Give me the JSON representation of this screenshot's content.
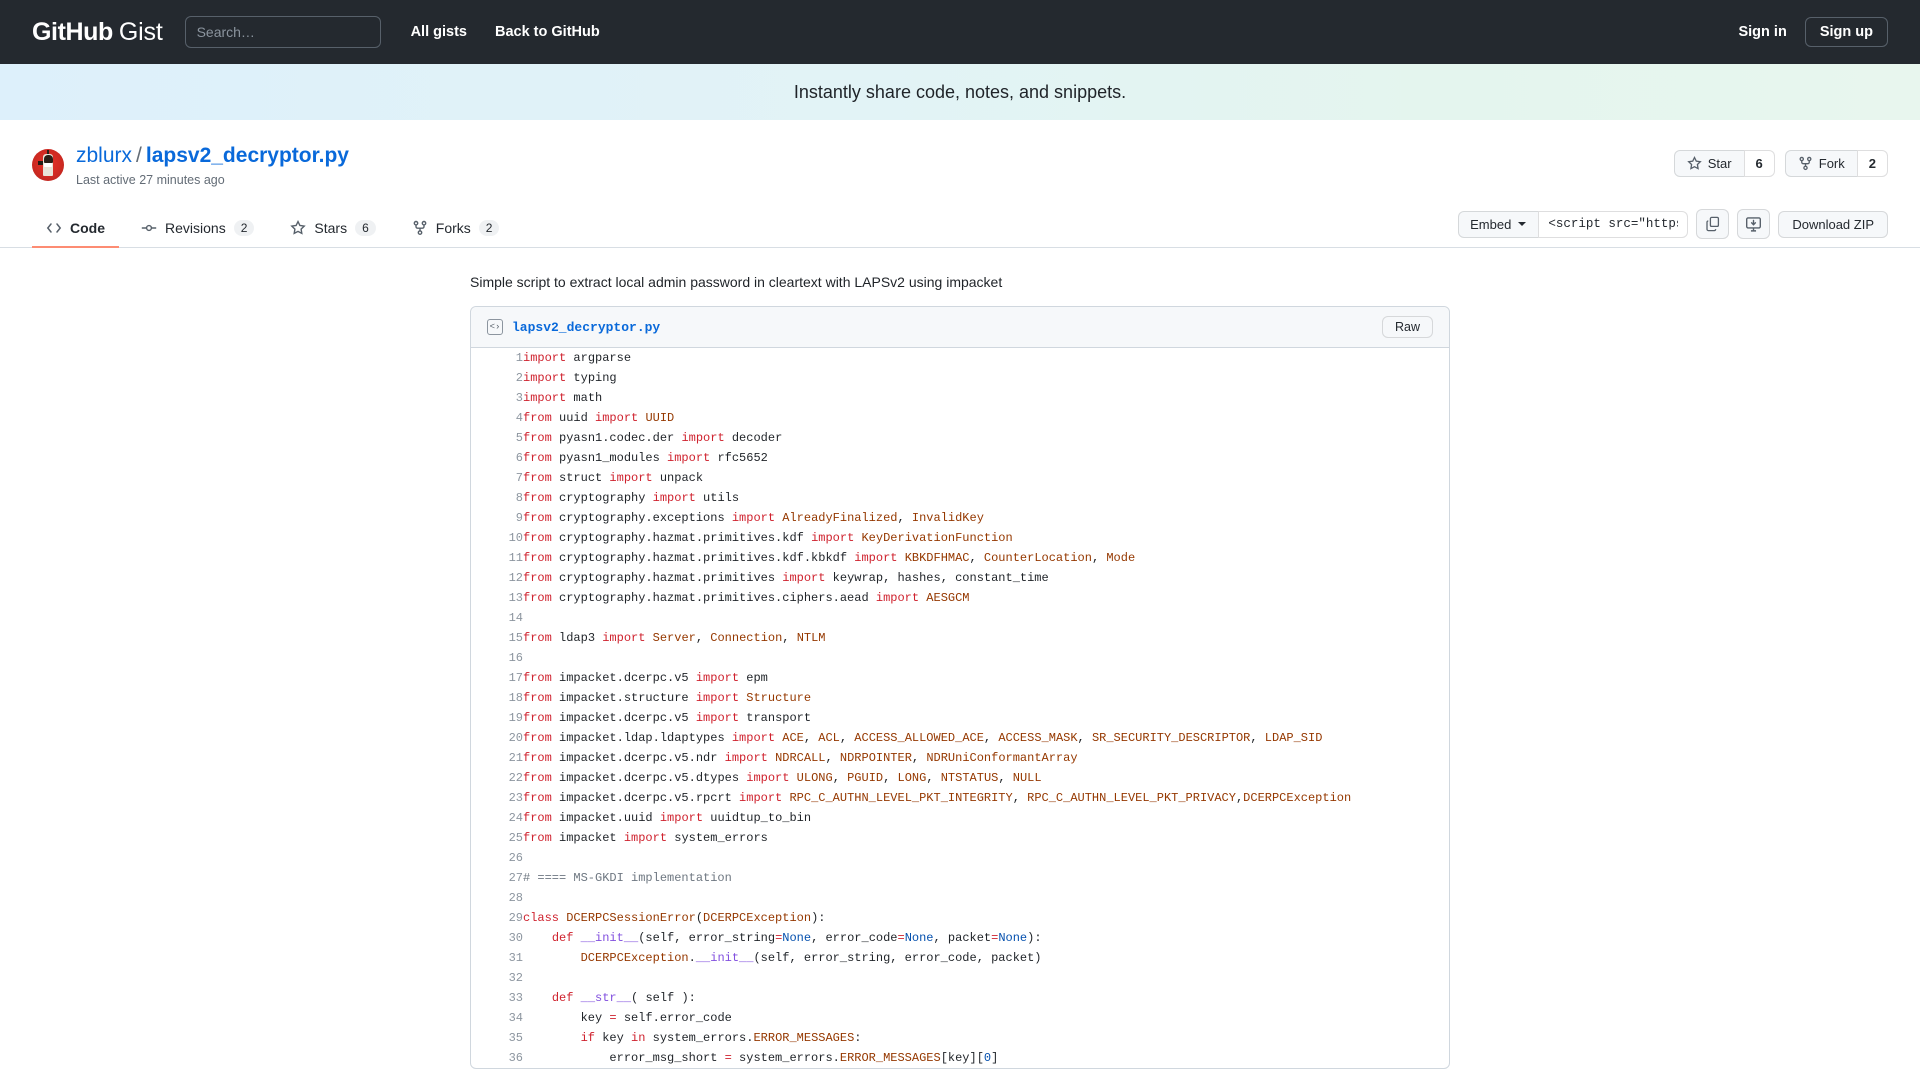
{
  "topbar": {
    "logo_github": "GitHub",
    "logo_gist": "Gist",
    "search_placeholder": "Search…",
    "links": [
      {
        "label": "All gists"
      },
      {
        "label": "Back to GitHub"
      }
    ],
    "sign_in": "Sign in",
    "sign_up": "Sign up"
  },
  "hero": {
    "text": "Instantly share code, notes, and snippets."
  },
  "gist": {
    "owner": "zblurx",
    "separator": "/",
    "filename": "lapsv2_decryptor.py",
    "last_active": "Last active 27 minutes ago",
    "description": "Simple script to extract local admin password in cleartext with LAPSv2 using impacket",
    "star_label": "Star",
    "star_count": "6",
    "fork_label": "Fork",
    "fork_count": "2"
  },
  "tabs": [
    {
      "label": "Code",
      "count": "",
      "icon": "code-icon",
      "active": true
    },
    {
      "label": "Revisions",
      "count": "2",
      "icon": "commit-icon",
      "active": false
    },
    {
      "label": "Stars",
      "count": "6",
      "icon": "star-icon",
      "active": false
    },
    {
      "label": "Forks",
      "count": "2",
      "icon": "fork-icon",
      "active": false
    }
  ],
  "toolbar": {
    "embed_label": "Embed",
    "embed_value": "<script src=\"https://g",
    "copy_icon": "copy-icon",
    "clone_icon": "clone-desktop-icon",
    "download_label": "Download ZIP"
  },
  "file": {
    "name": "lapsv2_decryptor.py",
    "raw_label": "Raw",
    "lines": [
      {
        "n": "1",
        "html": "<span class=\"k\">import</span> argparse"
      },
      {
        "n": "2",
        "html": "<span class=\"k\">import</span> typing"
      },
      {
        "n": "3",
        "html": "<span class=\"k\">import</span> math"
      },
      {
        "n": "4",
        "html": "<span class=\"k\">from</span> uuid <span class=\"k\">import</span> <span class=\"n\">UUID</span>"
      },
      {
        "n": "5",
        "html": "<span class=\"k\">from</span> pyasn1.codec.der <span class=\"k\">import</span> decoder"
      },
      {
        "n": "6",
        "html": "<span class=\"k\">from</span> pyasn1_modules <span class=\"k\">import</span> rfc5652"
      },
      {
        "n": "7",
        "html": "<span class=\"k\">from</span> struct <span class=\"k\">import</span> unpack"
      },
      {
        "n": "8",
        "html": "<span class=\"k\">from</span> cryptography <span class=\"k\">import</span> utils"
      },
      {
        "n": "9",
        "html": "<span class=\"k\">from</span> cryptography.exceptions <span class=\"k\">import</span> <span class=\"n\">AlreadyFinalized</span>, <span class=\"n\">InvalidKey</span>"
      },
      {
        "n": "10",
        "html": "<span class=\"k\">from</span> cryptography.hazmat.primitives.kdf <span class=\"k\">import</span> <span class=\"n\">KeyDerivationFunction</span>"
      },
      {
        "n": "11",
        "html": "<span class=\"k\">from</span> cryptography.hazmat.primitives.kdf.kbkdf <span class=\"k\">import</span> <span class=\"n\">KBKDFHMAC</span>, <span class=\"n\">CounterLocation</span>, <span class=\"n\">Mode</span>"
      },
      {
        "n": "12",
        "html": "<span class=\"k\">from</span> cryptography.hazmat.primitives <span class=\"k\">import</span> keywrap, hashes, constant_time"
      },
      {
        "n": "13",
        "html": "<span class=\"k\">from</span> cryptography.hazmat.primitives.ciphers.aead <span class=\"k\">import</span> <span class=\"n\">AESGCM</span>"
      },
      {
        "n": "14",
        "html": ""
      },
      {
        "n": "15",
        "html": "<span class=\"k\">from</span> ldap3 <span class=\"k\">import</span> <span class=\"n\">Server</span>, <span class=\"n\">Connection</span>, <span class=\"n\">NTLM</span>"
      },
      {
        "n": "16",
        "html": ""
      },
      {
        "n": "17",
        "html": "<span class=\"k\">from</span> impacket.dcerpc.v5 <span class=\"k\">import</span> epm"
      },
      {
        "n": "18",
        "html": "<span class=\"k\">from</span> impacket.structure <span class=\"k\">import</span> <span class=\"n\">Structure</span>"
      },
      {
        "n": "19",
        "html": "<span class=\"k\">from</span> impacket.dcerpc.v5 <span class=\"k\">import</span> transport"
      },
      {
        "n": "20",
        "html": "<span class=\"k\">from</span> impacket.ldap.ldaptypes <span class=\"k\">import</span> <span class=\"n\">ACE</span>, <span class=\"n\">ACL</span>, <span class=\"n\">ACCESS_ALLOWED_ACE</span>, <span class=\"n\">ACCESS_MASK</span>, <span class=\"n\">SR_SECURITY_DESCRIPTOR</span>, <span class=\"n\">LDAP_SID</span>"
      },
      {
        "n": "21",
        "html": "<span class=\"k\">from</span> impacket.dcerpc.v5.ndr <span class=\"k\">import</span> <span class=\"n\">NDRCALL</span>, <span class=\"n\">NDRPOINTER</span>, <span class=\"n\">NDRUniConformantArray</span>"
      },
      {
        "n": "22",
        "html": "<span class=\"k\">from</span> impacket.dcerpc.v5.dtypes <span class=\"k\">import</span> <span class=\"n\">ULONG</span>, <span class=\"n\">PGUID</span>, <span class=\"n\">LONG</span>, <span class=\"n\">NTSTATUS</span>, <span class=\"n\">NULL</span>"
      },
      {
        "n": "23",
        "html": "<span class=\"k\">from</span> impacket.dcerpc.v5.rpcrt <span class=\"k\">import</span> <span class=\"n\">RPC_C_AUTHN_LEVEL_PKT_INTEGRITY</span>, <span class=\"n\">RPC_C_AUTHN_LEVEL_PKT_PRIVACY</span>,<span class=\"n\">DCERPCException</span>"
      },
      {
        "n": "24",
        "html": "<span class=\"k\">from</span> impacket.uuid <span class=\"k\">import</span> uuidtup_to_bin"
      },
      {
        "n": "25",
        "html": "<span class=\"k\">from</span> impacket <span class=\"k\">import</span> system_errors"
      },
      {
        "n": "26",
        "html": ""
      },
      {
        "n": "27",
        "html": "<span class=\"c\"># ==== MS-GKDI implementation</span>"
      },
      {
        "n": "28",
        "html": ""
      },
      {
        "n": "29",
        "html": "<span class=\"k\">class</span> <span class=\"n\">DCERPCSessionError</span>(<span class=\"n\">DCERPCException</span>):"
      },
      {
        "n": "30",
        "html": "    <span class=\"k\">def</span> <span class=\"f\">__init__</span>(self, error_string<span class=\"k\">=</span><span class=\"v\">None</span>, error_code<span class=\"k\">=</span><span class=\"v\">None</span>, packet<span class=\"k\">=</span><span class=\"v\">None</span>):"
      },
      {
        "n": "31",
        "html": "        <span class=\"n\">DCERPCException</span>.<span class=\"f\">__init__</span>(self, error_string, error_code, packet)"
      },
      {
        "n": "32",
        "html": ""
      },
      {
        "n": "33",
        "html": "    <span class=\"k\">def</span> <span class=\"f\">__str__</span>( self ):"
      },
      {
        "n": "34",
        "html": "        key <span class=\"k\">=</span> self.error_code"
      },
      {
        "n": "35",
        "html": "        <span class=\"k\">if</span> key <span class=\"k\">in</span> system_errors.<span class=\"n\">ERROR_MESSAGES</span>:"
      },
      {
        "n": "36",
        "html": "            error_msg_short <span class=\"k\">=</span> system_errors.<span class=\"n\">ERROR_MESSAGES</span>[key][<span class=\"v\">0</span>]"
      }
    ]
  }
}
